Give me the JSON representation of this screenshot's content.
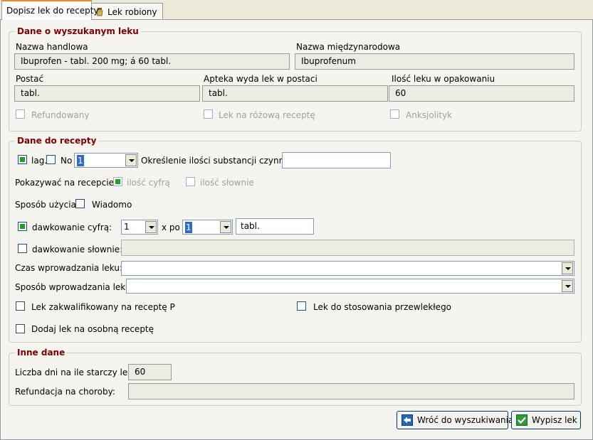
{
  "tabs": [
    {
      "label": "Dopisz lek do recepty",
      "active": true
    },
    {
      "label": "Lek robiony",
      "active": false,
      "icon": "mortar-icon"
    }
  ],
  "drug_info": {
    "title": "Dane o wyszukanym leku",
    "trade_name_label": "Nazwa handlowa",
    "trade_name": "Ibuprofen - tabl. 200 mg; á 60 tabl.",
    "intl_name_label": "Nazwa międzynarodowa",
    "intl_name": "Ibuprofenum",
    "form_label": "Postać",
    "form": "tabl.",
    "pharmacy_form_label": "Apteka wyda lek w postaci",
    "pharmacy_form": "tabl.",
    "pack_qty_label": "Ilość leku w opakowaniu",
    "pack_qty": "60",
    "refunded_label": "Refundowany",
    "pink_rx_label": "Lek na różową receptę",
    "anxiolytic_label": "Anksjolityk"
  },
  "rx_data": {
    "title": "Dane do recepty",
    "lag_label": "lag.",
    "no_label": "No",
    "no_value": "1",
    "substance_label": "Określenie ilości substancji czynnej :",
    "substance_value": "",
    "show_label": "Pokazywać na recepcie:",
    "show_digits_label": "ilość cyfrą",
    "show_words_label": "ilość słownie",
    "usage_label": "Sposób użycia:",
    "known_label": "Wiadomo",
    "dose_digits_label": "dawkowanie cyfrą:",
    "dose_count": "1",
    "x_po_label": "x po",
    "dose_amount": "1",
    "dose_unit": "tabl.",
    "dose_words_label": "dawkowanie słownie:",
    "dose_words_value": "",
    "duration_label": "Czas wprowadzania leku:",
    "duration_value": "",
    "method_label": "Sposób wprowadzania leku:",
    "method_value": "",
    "qualified_p_label": "Lek zakwalifikowany na receptę P",
    "chronic_label": "Lek do stosowania przewlekłego",
    "separate_rx_label": "Dodaj lek na osobną receptę",
    "checked": {
      "lag": true,
      "no": false,
      "show_digits": true,
      "show_words": false,
      "known": false,
      "dose_digits": true,
      "dose_words": false,
      "qualified_p": false,
      "chronic": false,
      "separate_rx": false
    }
  },
  "other": {
    "title": "Inne dane",
    "days_label": "Liczba dni na ile starczy leku:",
    "days_value": "60",
    "refund_diseases_label": "Refundacja na choroby:",
    "refund_diseases_value": ""
  },
  "buttons": {
    "back_label": "Wróć do wyszukiwania",
    "prescribe_label": "Wypisz lek"
  },
  "colors": {
    "group_title": "#800000",
    "accent_tab": "#e68b2c",
    "check_fill": "#21a121"
  }
}
